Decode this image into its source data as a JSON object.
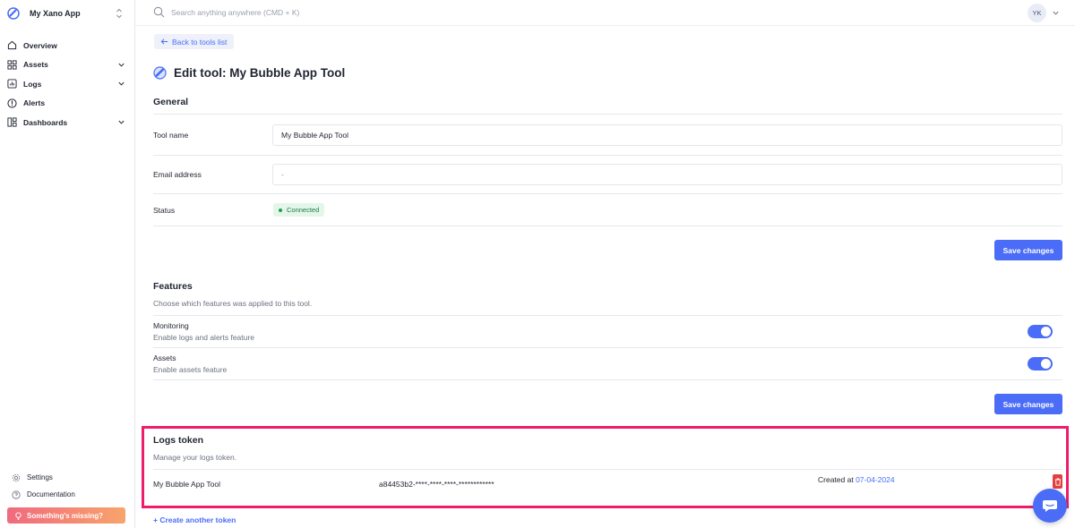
{
  "app": {
    "name": "My Xano App"
  },
  "sidebar": {
    "items": [
      {
        "label": "Overview",
        "icon": "home-icon",
        "has_chevron": false
      },
      {
        "label": "Assets",
        "icon": "grid-icon",
        "has_chevron": true
      },
      {
        "label": "Logs",
        "icon": "logs-icon",
        "has_chevron": true
      },
      {
        "label": "Alerts",
        "icon": "alert-icon",
        "has_chevron": false
      },
      {
        "label": "Dashboards",
        "icon": "dashboard-icon",
        "has_chevron": true
      }
    ],
    "bottom": [
      {
        "label": "Settings",
        "icon": "gear-icon"
      },
      {
        "label": "Documentation",
        "icon": "help-icon"
      }
    ],
    "missing_label": "Something's missing?"
  },
  "topbar": {
    "search_placeholder": "Search anything anywhere (CMD + K)",
    "avatar_initials": "YK"
  },
  "main": {
    "back_label": "Back to tools list",
    "page_title": "Edit tool: My Bubble App Tool",
    "general": {
      "title": "General",
      "tool_name_label": "Tool name",
      "tool_name_value": "My Bubble App Tool",
      "email_label": "Email address",
      "email_value": "-",
      "status_label": "Status",
      "status_value": "Connected",
      "save_label": "Save changes"
    },
    "features": {
      "title": "Features",
      "description": "Choose which features was applied to this tool.",
      "items": [
        {
          "name": "Monitoring",
          "desc": "Enable logs and alerts feature",
          "enabled": true
        },
        {
          "name": "Assets",
          "desc": "Enable assets feature",
          "enabled": true
        }
      ],
      "save_label": "Save changes"
    },
    "logs_token": {
      "title": "Logs token",
      "description": "Manage your logs token.",
      "token_name": "My Bubble App Tool",
      "token_value": "a84453b2-****-****-****-************",
      "created_prefix": "Created at",
      "created_date": "07-04-2024",
      "create_another_label": "+ Create another token"
    }
  },
  "colors": {
    "accent": "#4a6cf7",
    "highlight": "#ee1c6b",
    "danger": "#e53e3e",
    "success": "#1f9d55"
  }
}
